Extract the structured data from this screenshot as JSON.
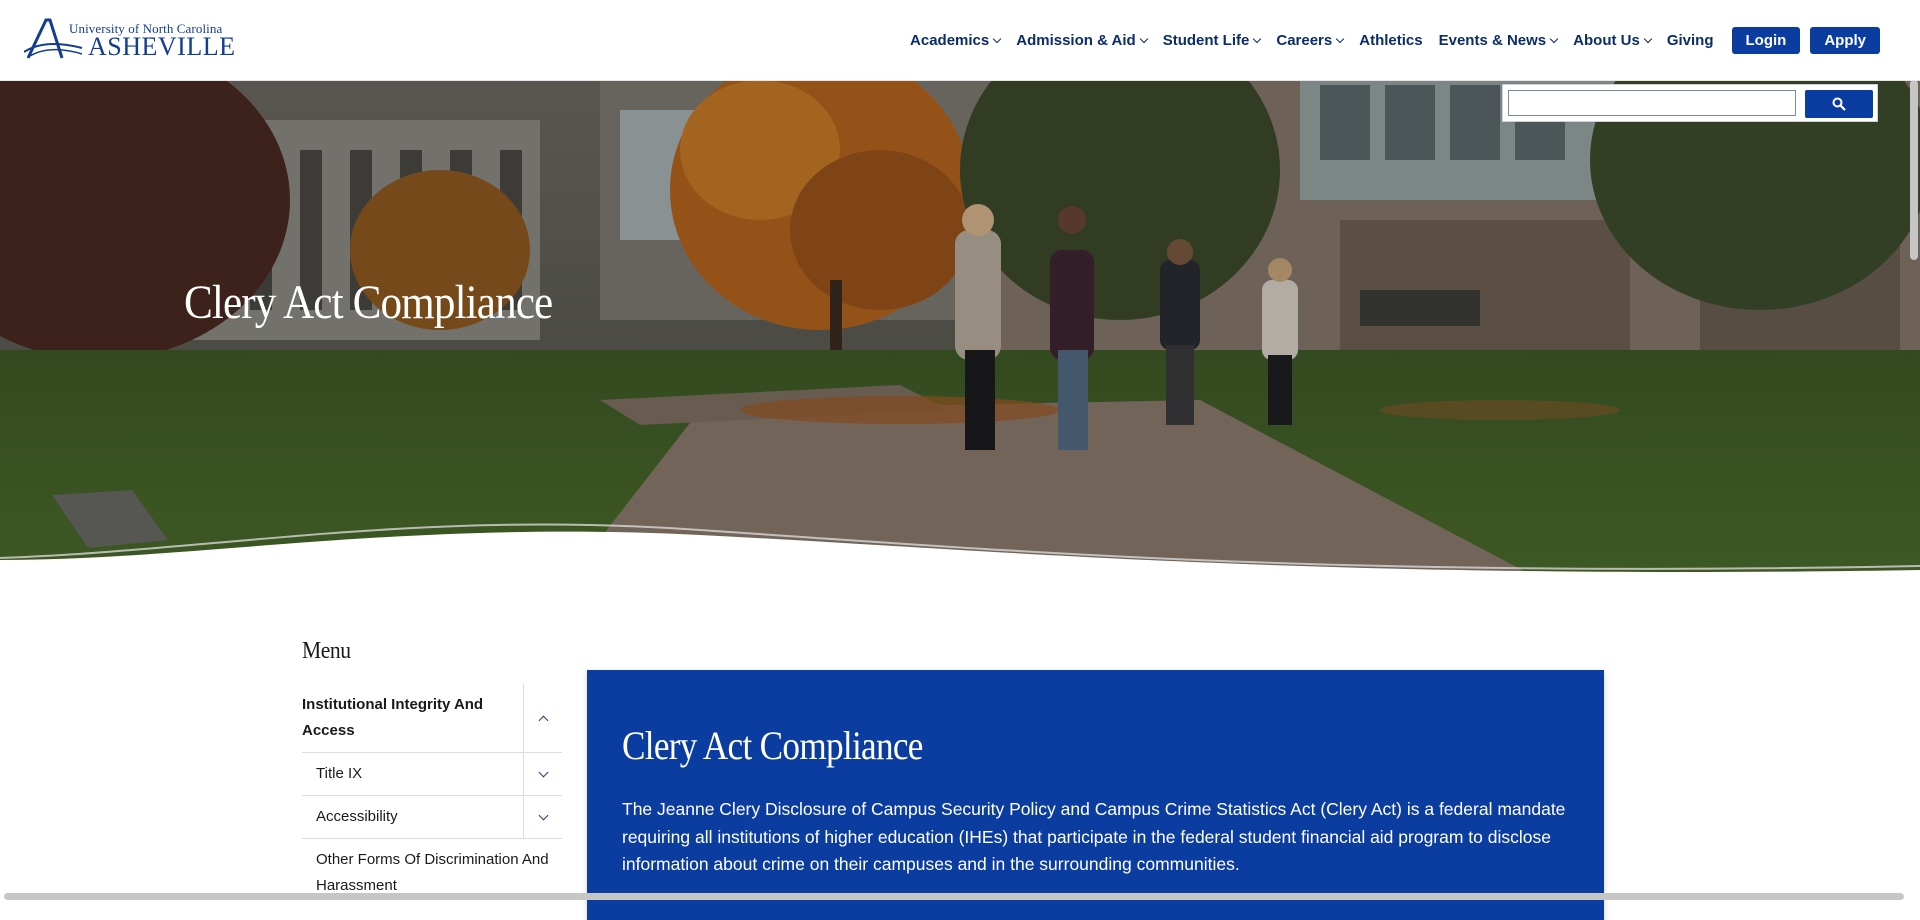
{
  "header": {
    "logo_top": "University of North Carolina",
    "logo_bottom": "ASHEVILLE",
    "nav": [
      {
        "label": "Academics",
        "dropdown": true
      },
      {
        "label": "Admission & Aid",
        "dropdown": true
      },
      {
        "label": "Student Life",
        "dropdown": true
      },
      {
        "label": "Careers",
        "dropdown": true
      },
      {
        "label": "Athletics",
        "dropdown": false
      },
      {
        "label": "Events & News",
        "dropdown": true
      },
      {
        "label": "About Us",
        "dropdown": true
      },
      {
        "label": "Giving",
        "dropdown": false
      }
    ],
    "login_label": "Login",
    "apply_label": "Apply"
  },
  "search": {
    "value": "",
    "button_icon": "search-icon"
  },
  "hero": {
    "title": "Clery Act Compliance"
  },
  "sidebar": {
    "title": "Menu",
    "items": [
      {
        "label": "Institutional Integrity And Access",
        "level": "top",
        "toggle": "up"
      },
      {
        "label": "Title IX",
        "level": "sub",
        "toggle": "down"
      },
      {
        "label": "Accessibility",
        "level": "sub",
        "toggle": "down"
      },
      {
        "label": "Other Forms Of Discrimination And Harassment",
        "level": "sub",
        "toggle": "none"
      }
    ]
  },
  "content": {
    "title": "Clery Act Compliance",
    "body": "The Jeanne Clery Disclosure of Campus Security Policy and Campus Crime Statistics Act (Clery Act) is a federal mandate requiring all institutions of higher education (IHEs) that participate in the federal student financial aid program to disclose information about crime on their campuses and in the surrounding communities."
  },
  "colors": {
    "brand_blue": "#0b3ca0",
    "nav_text": "#0c2d6b"
  }
}
